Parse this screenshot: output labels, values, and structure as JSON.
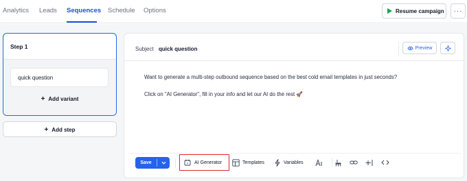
{
  "nav": {
    "tabs": [
      {
        "label": "Analytics",
        "active": false
      },
      {
        "label": "Leads",
        "active": false
      },
      {
        "label": "Sequences",
        "active": true
      },
      {
        "label": "Schedule",
        "active": false
      },
      {
        "label": "Options",
        "active": false
      }
    ],
    "resume_label": "Resume campaign",
    "more_label": "···"
  },
  "steps": {
    "step_title": "Step 1",
    "variant_subject": "quick question",
    "add_variant_label": "Add variant",
    "add_step_label": "Add step"
  },
  "editor": {
    "subject_label": "Subject",
    "subject_value": "quick question",
    "preview_label": "Preview",
    "body_lines": [
      "Want to generate a multi-step outbound sequence based on the best cold email templates in just seconds?",
      "Click on \"AI Generator\", fill in your info and let our AI do the rest 🚀"
    ]
  },
  "toolbar": {
    "save_label": "Save",
    "ai_generator_label": "AI Generator",
    "templates_label": "Templates",
    "variables_label": "Variables"
  },
  "colors": {
    "accent": "#2563eb",
    "play": "#16a34a",
    "highlight": "#dc2626"
  },
  "icons": [
    "play-icon",
    "more-icon",
    "plus-icon",
    "eye-icon",
    "sparkle-icon",
    "chevron-down-icon",
    "calendar-icon",
    "templates-icon",
    "variables-icon",
    "text-size-icon",
    "paint-brush-icon",
    "link-icon",
    "separator-icon",
    "code-icon"
  ]
}
